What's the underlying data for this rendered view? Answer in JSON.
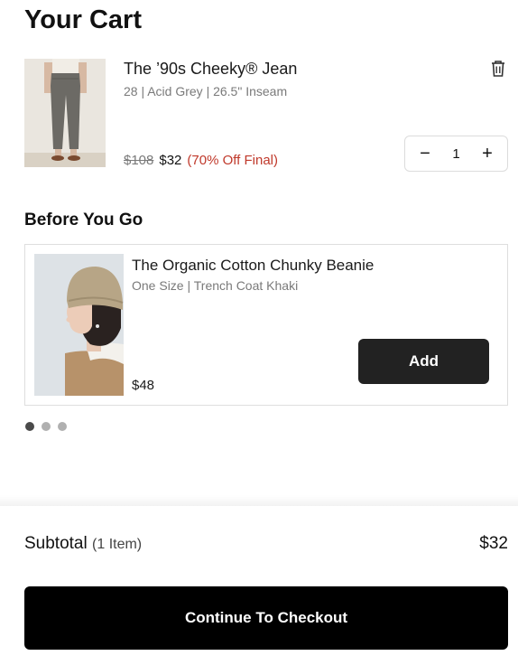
{
  "header": {
    "title": "Your Cart"
  },
  "cart": {
    "items": [
      {
        "image_icon": "jeans-product-photo",
        "name": "The ’90s Cheeky® Jean",
        "variant": "28 | Acid Grey | 26.5\" Inseam",
        "price_original": "$108",
        "price_sale": "$32",
        "discount": "(70% Off Final)",
        "quantity": "1",
        "quantity_decrease": "−",
        "quantity_increase": "+"
      }
    ]
  },
  "recommendations": {
    "heading": "Before You Go",
    "items": [
      {
        "image_icon": "beanie-product-photo",
        "name": "The Organic Cotton Chunky Beanie",
        "variant": "One Size | Trench Coat Khaki",
        "price": "$48",
        "add_label": "Add"
      }
    ],
    "pagination": {
      "count": 3,
      "active": 0
    }
  },
  "footer": {
    "subtotal_label": "Subtotal",
    "subtotal_count": "(1 Item)",
    "subtotal_value": "$32",
    "checkout_label": "Continue To Checkout"
  },
  "colors": {
    "discount": "#c0392b",
    "button_dark": "#222222",
    "checkout": "#000000"
  }
}
